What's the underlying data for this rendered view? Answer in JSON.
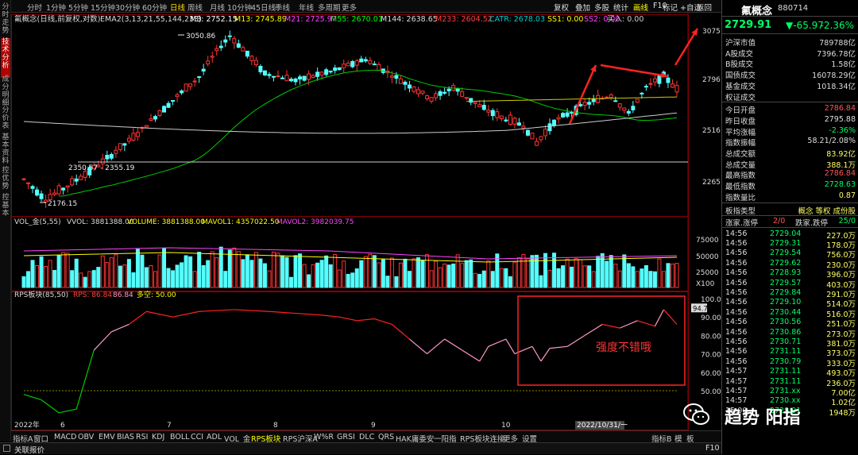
{
  "left_tabs": [
    {
      "label": "分时走势",
      "active": false
    },
    {
      "label": "技术分析",
      "active": true
    },
    {
      "label": "成分明细",
      "active": false
    },
    {
      "label": "分价表",
      "active": false
    },
    {
      "label": "基本资料",
      "active": false
    },
    {
      "label": "控优势",
      "active": false
    },
    {
      "label": "控基本",
      "active": false
    }
  ],
  "periods": [
    {
      "label": "分时",
      "active": false
    },
    {
      "label": "1分钟",
      "active": false
    },
    {
      "label": "5分钟",
      "active": false
    },
    {
      "label": "15分钟",
      "active": false
    },
    {
      "label": "30分钟",
      "active": false
    },
    {
      "label": "60分钟",
      "active": false
    },
    {
      "label": "日线",
      "active": true
    },
    {
      "label": "周线",
      "active": false
    },
    {
      "label": "月线",
      "active": false
    },
    {
      "label": "10分钟",
      "active": false
    },
    {
      "label": "45日线",
      "active": false
    },
    {
      "label": "季线",
      "active": false
    },
    {
      "label": "年线",
      "active": false
    },
    {
      "label": "多周期",
      "active": false
    },
    {
      "label": "更多",
      "active": false
    }
  ],
  "toolbar_right": [
    {
      "label": "复权",
      "active": false
    },
    {
      "label": "叠加",
      "active": false
    },
    {
      "label": "多股",
      "active": false
    },
    {
      "label": "统计",
      "active": false
    },
    {
      "label": "画线",
      "active": true
    },
    {
      "label": "F10",
      "active": false
    },
    {
      "label": "标记",
      "active": false
    },
    {
      "label": "+自选",
      "active": false
    },
    {
      "label": "返回",
      "active": false
    }
  ],
  "indicator_line": {
    "name": "氟概念(日线,前复权,对数)",
    "ema": "EMA2(3,13,21,55,144,233)",
    "items": [
      {
        "text": "M3: 2752.15",
        "color": "#ffffff"
      },
      {
        "text": "M13: 2745.89",
        "color": "#ffff00"
      },
      {
        "text": "M21: 2725.97",
        "color": "#ff44ff"
      },
      {
        "text": "M55: 2670.01",
        "color": "#00ff00"
      },
      {
        "text": "M144: 2638.65",
        "color": "#dddddd"
      },
      {
        "text": "M233: 2604.52",
        "color": "#ff4444"
      },
      {
        "text": "CATR: 2678.03",
        "color": "#00cccc"
      },
      {
        "text": "SS1: 0.00",
        "color": "#ffff00"
      },
      {
        "text": "SS2: 0.00",
        "color": "#ff44ff"
      },
      {
        "text": "买入: 0.00",
        "color": "#cccccc"
      }
    ]
  },
  "price_axis": [
    "3075",
    "2796",
    "2516",
    "2265"
  ],
  "price_annotations": {
    "high": "3050.86",
    "low": "2176.15",
    "line_label": "2350.57 - 2355.19"
  },
  "vol_line": {
    "name": "VOL_金(5,55)",
    "vvol": "VVOL: 3881388.00",
    "volume": "VOLUME: 3881388.00",
    "ma1": "MAVOL1: 4357022.50",
    "ma2": "MAVOL2: 3982039.75"
  },
  "vol_axis": [
    "75000",
    "50000",
    "25000",
    "X100"
  ],
  "rps_line": {
    "name": "RPS板块(85,50)",
    "rps": "RPS: 86.84",
    "val": "86.84",
    "dup": "多空: 50.00"
  },
  "rps_axis": [
    "100.0",
    "90.00",
    "80.00",
    "70.00",
    "60.00",
    "50.00"
  ],
  "rps_current": "94.7",
  "date_axis": [
    "2022年",
    "6",
    "7",
    "8",
    "9",
    "10"
  ],
  "date_cursor": "2022/10/31/一",
  "annotation_text": "强度不错哦",
  "bottom_tabs": [
    {
      "label": "指标A",
      "active": false
    },
    {
      "label": "窗口",
      "active": false
    },
    {
      "label": "MACD",
      "active": false
    },
    {
      "label": "OBV",
      "active": false
    },
    {
      "label": "EMV",
      "active": false
    },
    {
      "label": "BIAS",
      "active": false
    },
    {
      "label": "RSI",
      "active": false
    },
    {
      "label": "KDJ",
      "active": false
    },
    {
      "label": "BOLL",
      "active": false
    },
    {
      "label": "CCI",
      "active": false
    },
    {
      "label": "ADL",
      "active": false
    },
    {
      "label": "VOL_金",
      "active": false
    },
    {
      "label": "RPS板块",
      "active": true
    },
    {
      "label": "RPS沪深A",
      "active": false
    },
    {
      "label": "W%R",
      "active": false
    },
    {
      "label": "GRSI",
      "active": false
    },
    {
      "label": "DLC",
      "active": false
    },
    {
      "label": "QRS",
      "active": false
    },
    {
      "label": "HAK庸委安",
      "active": false
    },
    {
      "label": "一阳指",
      "active": false
    },
    {
      "label": "RPS板块连接",
      "active": false
    },
    {
      "label": "更多",
      "active": false
    },
    {
      "label": "设置",
      "active": false
    }
  ],
  "bottom_right": {
    "a": "指标B",
    "b": "模",
    "c": "板"
  },
  "status": {
    "label": "关联报价",
    "key": "F10"
  },
  "rp": {
    "title": "氟概念",
    "code": "880714",
    "last": "2729.91",
    "chg": "▼-65.97",
    "pct": "-2.36%",
    "stats": [
      {
        "label": "沪深市值",
        "value": "789788亿",
        "color": "#dddddd"
      },
      {
        "label": "A股成交",
        "value": "7396.78亿",
        "color": "#dddddd"
      },
      {
        "label": "B股成交",
        "value": "1.58亿",
        "color": "#dddddd"
      },
      {
        "label": "国债成交",
        "value": "16078.29亿",
        "color": "#dddddd"
      },
      {
        "label": "基金成交",
        "value": "1018.34亿",
        "color": "#dddddd"
      },
      {
        "label": "权证成交",
        "value": "",
        "color": "#dddddd"
      },
      {
        "label": "今日开盘",
        "value": "2786.84",
        "color": "#ff5555"
      },
      {
        "label": "昨日收盘",
        "value": "2795.88",
        "color": "#dddddd"
      },
      {
        "label": "平均涨幅",
        "value": "-2.36%",
        "color": "#00ff66"
      },
      {
        "label": "指数振幅",
        "value": "58.21/2.08%",
        "color": "#dddddd"
      },
      {
        "label": "总成交额",
        "value": "83.92亿",
        "color": "#ffff66"
      },
      {
        "label": "总成交量",
        "value": "388.1万",
        "color": "#ffff66"
      },
      {
        "label": "最高指数",
        "value": "2786.84",
        "color": "#ff5555"
      },
      {
        "label": "最低指数",
        "value": "2728.63",
        "color": "#00ff66"
      },
      {
        "label": "指数量比",
        "value": "0.87",
        "color": "#ffff66"
      }
    ],
    "board_type": {
      "label": "板指类型",
      "value": "概念 等权 成份股"
    },
    "up_label": "涨家.涨停",
    "up_value": "2/0",
    "down_label": "跌家.跌停",
    "down_value": "25/0",
    "ticks": [
      [
        "14:56",
        "2729.04",
        "227.0万"
      ],
      [
        "14:56",
        "2729.31",
        "178.0万"
      ],
      [
        "14:56",
        "2729.54",
        "756.0万"
      ],
      [
        "14:56",
        "2729.62",
        "230.0万"
      ],
      [
        "14:56",
        "2728.93",
        "396.0万"
      ],
      [
        "14:56",
        "2729.57",
        "403.0万"
      ],
      [
        "14:56",
        "2729.84",
        "291.0万"
      ],
      [
        "14:56",
        "2729.10",
        "514.0万"
      ],
      [
        "14:56",
        "2730.44",
        "516.0万"
      ],
      [
        "14:56",
        "2730.56",
        "251.0万"
      ],
      [
        "14:56",
        "2730.86",
        "273.0万"
      ],
      [
        "14:56",
        "2730.71",
        "381.0万"
      ],
      [
        "14:56",
        "2731.11",
        "373.0万"
      ],
      [
        "14:56",
        "2730.79",
        "333.0万"
      ],
      [
        "14:57",
        "2731.11",
        "493.0万"
      ],
      [
        "14:57",
        "2731.11",
        "236.0万"
      ],
      [
        "14:57",
        "2731.xx",
        "7.00亿"
      ],
      [
        "14:57",
        "2730.xx",
        "1.02亿"
      ],
      [
        "15:00",
        "2729.91",
        "1948万"
      ]
    ]
  },
  "watermark": "趋势 阳指",
  "chart_data": {
    "type": "candlestick",
    "x": [
      "2022年",
      "6",
      "7",
      "8",
      "9",
      "10"
    ],
    "ylim": [
      2176.15,
      3075
    ],
    "high": 3050.86,
    "low": 2176.15,
    "last_close": 2729.91,
    "rps_current": 94.7,
    "rps_ylim": [
      50,
      100
    ]
  }
}
